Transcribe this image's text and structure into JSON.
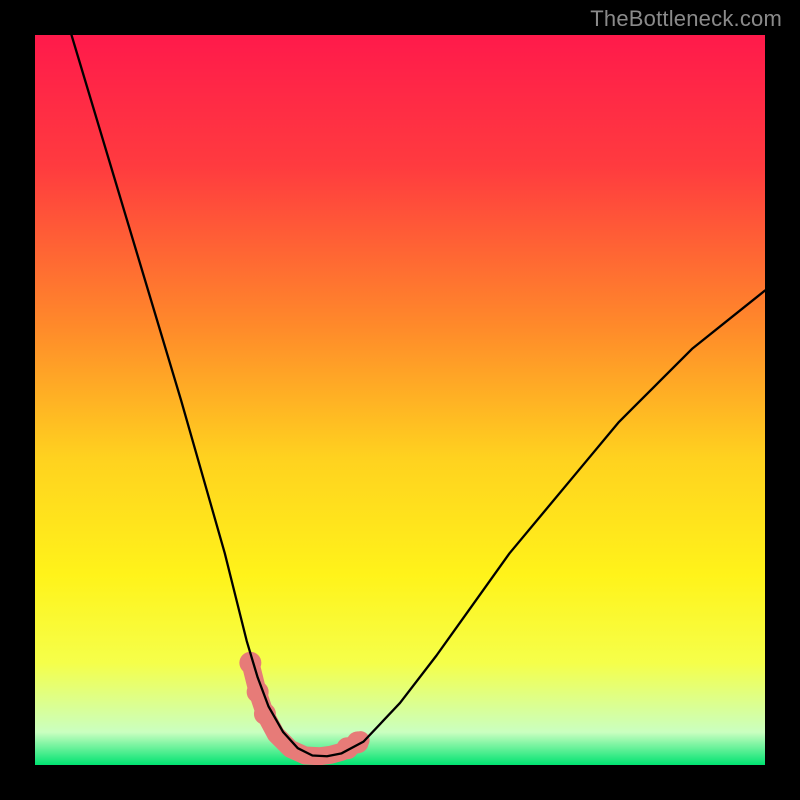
{
  "watermark": "TheBottleneck.com",
  "chart_data": {
    "type": "line",
    "title": "",
    "xlabel": "",
    "ylabel": "",
    "xlim": [
      0,
      100
    ],
    "ylim": [
      0,
      100
    ],
    "gradient_stops": [
      {
        "offset": 0.0,
        "color": "#ff1a4b"
      },
      {
        "offset": 0.18,
        "color": "#ff3b3f"
      },
      {
        "offset": 0.4,
        "color": "#ff8a2a"
      },
      {
        "offset": 0.58,
        "color": "#ffd21f"
      },
      {
        "offset": 0.74,
        "color": "#fff31a"
      },
      {
        "offset": 0.86,
        "color": "#f5ff4a"
      },
      {
        "offset": 0.955,
        "color": "#caffc0"
      },
      {
        "offset": 1.0,
        "color": "#00e371"
      }
    ],
    "series": [
      {
        "name": "curve",
        "x": [
          5,
          8,
          11,
          14,
          17,
          20,
          22,
          24,
          26,
          27.5,
          29,
          30.5,
          32,
          34,
          36,
          38,
          40,
          42,
          45,
          50,
          55,
          60,
          65,
          70,
          75,
          80,
          85,
          90,
          95,
          100
        ],
        "y": [
          100,
          90,
          80,
          70,
          60,
          50,
          43,
          36,
          29,
          23,
          17,
          12,
          8,
          4.5,
          2.3,
          1.3,
          1.2,
          1.6,
          3.2,
          8.5,
          15,
          22,
          29,
          35,
          41,
          47,
          52,
          57,
          61,
          65
        ],
        "stroke": "#000000",
        "stroke_width": 2.3
      },
      {
        "name": "highlight",
        "x": [
          29.5,
          30.5,
          31.5,
          33,
          35,
          37,
          39,
          40.5,
          42,
          43.5,
          44.6
        ],
        "y": [
          14,
          10,
          7,
          4.2,
          2.2,
          1.3,
          1.2,
          1.4,
          1.8,
          2.6,
          3.4
        ],
        "stroke": "#e77b78",
        "stroke_width": 18,
        "dots_x": [
          29.5,
          30.5,
          31.5,
          42.8,
          44.2
        ],
        "dots_y": [
          14,
          10,
          7,
          2.3,
          3.1
        ],
        "dot_r": 11,
        "dot_fill": "#e77b78"
      }
    ]
  }
}
